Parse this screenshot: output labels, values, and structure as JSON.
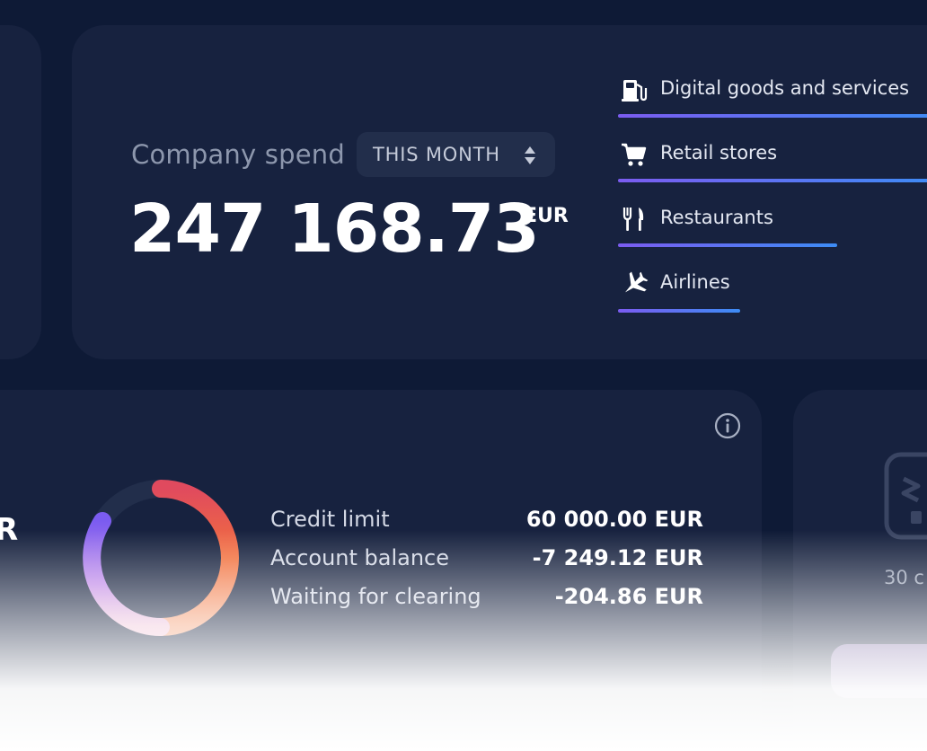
{
  "spend": {
    "label": "Company spend",
    "period": "THIS MONTH",
    "amount": "247 168.73",
    "currency": "EUR"
  },
  "categories": [
    {
      "name": "Digital goods and services",
      "icon": "fuel-pump-icon"
    },
    {
      "name": "Retail stores",
      "icon": "shopping-cart-icon"
    },
    {
      "name": "Restaurants",
      "icon": "fork-knife-icon"
    },
    {
      "name": "Airlines",
      "icon": "airplane-icon"
    }
  ],
  "balance": {
    "left_fragment": "R",
    "stats": [
      {
        "label": "Credit limit",
        "value": "60 000.00 EUR"
      },
      {
        "label": "Account balance",
        "value": "-7 249.12 EUR"
      },
      {
        "label": "Waiting for clearing",
        "value": "-204.86 EUR"
      }
    ]
  },
  "cards": {
    "count_text": "30 c"
  },
  "colors": {
    "background": "#0e1a36",
    "card": "#17223f",
    "bar_gradient_start": "#7b5cf0",
    "bar_gradient_end": "#3d8cf5",
    "donut_orange": "#f06a3c",
    "donut_purple": "#8b5cf6"
  }
}
